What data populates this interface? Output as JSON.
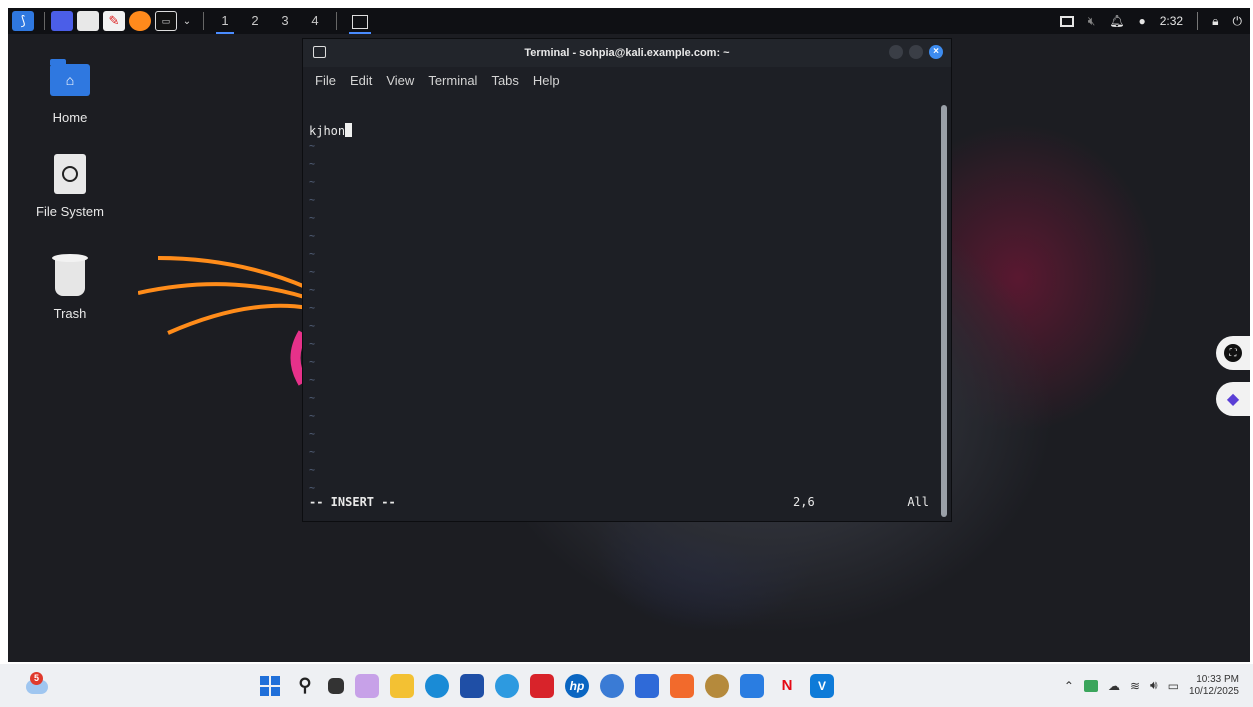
{
  "vm_taskbar": {
    "workspaces": [
      "1",
      "2",
      "3",
      "4"
    ],
    "active_workspace": "1",
    "clock": "2:32"
  },
  "desktop": {
    "icons": [
      {
        "label": "Home",
        "icon": "home-folder-icon"
      },
      {
        "label": "File System",
        "icon": "drive-icon"
      },
      {
        "label": "Trash",
        "icon": "trash-icon"
      }
    ]
  },
  "terminal": {
    "title": "Terminal - sohpia@kali.example.com: ~",
    "menu": [
      "File",
      "Edit",
      "View",
      "Terminal",
      "Tabs",
      "Help"
    ],
    "buffer_line": "kjhon",
    "tilde": "~",
    "mode": "-- INSERT --",
    "position": "2,6",
    "scroll_state": "All"
  },
  "host_taskbar": {
    "weather_badge": "5",
    "clock_time": "10:33 PM",
    "clock_date": "10/12/2025"
  },
  "colors": {
    "accent": "#3d8cf0",
    "desktop_bg": "#1c1d22",
    "terminal_bg": "#1d1f25"
  }
}
